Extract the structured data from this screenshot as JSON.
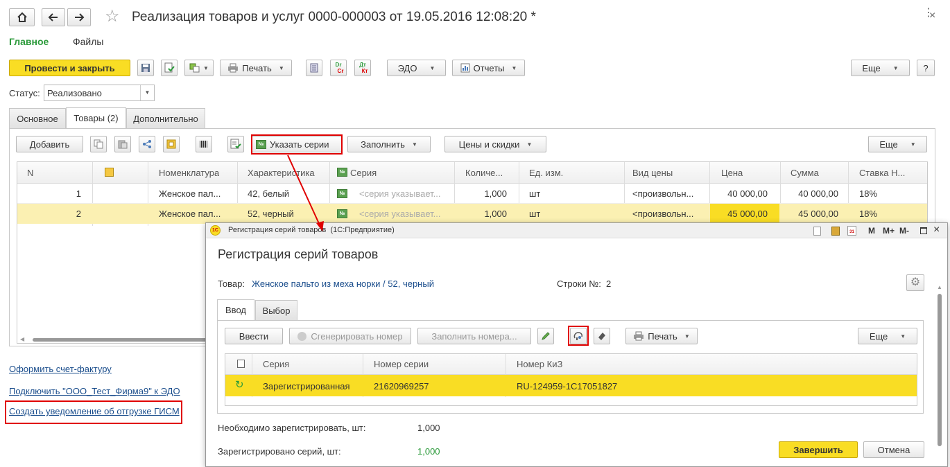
{
  "title": "Реализация товаров и услуг 0000-000003 от 19.05.2016 12:08:20 *",
  "nav_tabs": [
    "Главное",
    "Файлы"
  ],
  "toolbar": {
    "post_close": "Провести и закрыть",
    "print": "Печать",
    "edo": "ЭДО",
    "reports": "Отчеты",
    "more": "Еще",
    "help": "?",
    "dr_top": "Dr",
    "dr_bottom": "Cr",
    "dt_top": "Дт",
    "dt_bottom": "Кт"
  },
  "status": {
    "label": "Статус:",
    "value": "Реализовано"
  },
  "doc_tabs": [
    "Основное",
    "Товары (2)",
    "Дополнительно"
  ],
  "goods_toolbar": {
    "add": "Добавить",
    "series": "Указать серии",
    "fill": "Заполнить",
    "prices": "Цены и скидки",
    "more": "Еще"
  },
  "goods_table": {
    "headers": [
      "N",
      "Номенклатура",
      "Характеристика",
      "Серия",
      "Количе...",
      "Ед. изм.",
      "Вид цены",
      "Цена",
      "Сумма",
      "Ставка Н..."
    ],
    "rows": [
      {
        "n": "1",
        "item": "Женское пал...",
        "char": "42, белый",
        "series": "<серия указывает...",
        "qty": "1,000",
        "unit": "шт",
        "price_type": "<произвольн...",
        "price": "40 000,00",
        "sum": "40 000,00",
        "vat": "18%"
      },
      {
        "n": "2",
        "item": "Женское пал...",
        "char": "52, черный",
        "series": "<серия указывает...",
        "qty": "1,000",
        "unit": "шт",
        "price_type": "<произвольн...",
        "price": "45 000,00",
        "sum": "45 000,00",
        "vat": "18%"
      }
    ]
  },
  "links": [
    "Оформить счет-фактуру",
    "Подключить \"ООО_Тест_Фирма9\" к ЭДО",
    "Создать уведомление об отгрузке ГИСМ"
  ],
  "dialog": {
    "window_title": "Регистрация серий товаров  (1С:Предприятие)",
    "heading": "Регистрация серий товаров",
    "goods_label": "Товар:",
    "goods_value": "Женское пальто из меха норки / 52, черный",
    "rows_label": "Строки №:",
    "rows_value": "2",
    "tabs": [
      "Ввод",
      "Выбор"
    ],
    "toolbar": {
      "enter": "Ввести",
      "generate": "Сгенерировать номер",
      "fill_numbers": "Заполнить номера...",
      "print": "Печать",
      "more": "Еще"
    },
    "table": {
      "headers": [
        "Серия",
        "Номер серии",
        "Номер КиЗ"
      ],
      "rows": [
        {
          "series": "Зарегистрированная",
          "number": "21620969257",
          "kiz": "RU-124959-1C17051827"
        }
      ]
    },
    "need_label": "Необходимо зарегистрировать, шт:",
    "need_value": "1,000",
    "reg_label": "Зарегистрировано серий, шт:",
    "reg_value": "1,000",
    "finish": "Завершить",
    "cancel": "Отмена",
    "window_buttons": [
      "M",
      "M+",
      "M-"
    ],
    "cal_day": "31",
    "no_sign": "№"
  },
  "colors": {
    "accent_yellow": "#f9dd24",
    "selection_row": "#fbf0b2",
    "link": "#1a4d8c",
    "green": "#2b9a3a",
    "highlight_red": "#e00000"
  }
}
